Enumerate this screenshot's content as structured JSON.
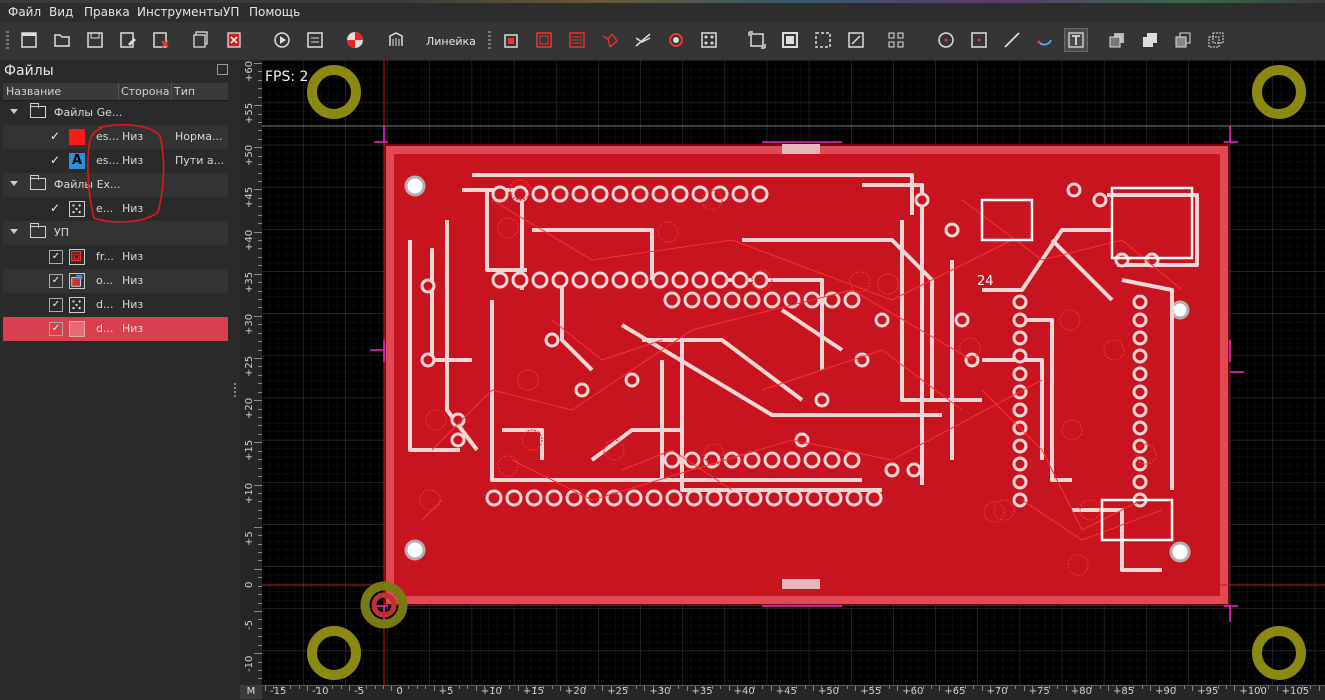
{
  "menu": {
    "items": [
      "Файл",
      "Вид",
      "Правка",
      "Инструменты",
      "УП",
      "Помощь"
    ]
  },
  "toolbar": {
    "ruler_label": "Линейка",
    "buttons": [
      "new-file-icon",
      "open-folder-icon",
      "save-icon",
      "save-as-icon",
      "close-file-icon",
      "save-all-icon",
      "close-all-icon",
      "run-icon",
      "settings-icon",
      "color-icon",
      "gcode-icon",
      "profile-icon",
      "pocket-icon",
      "pocket-raster-icon",
      "voronoi-icon",
      "thermal-icon",
      "drill-icon",
      "hatch-icon",
      "zero-icon",
      "home-icon",
      "boundary-icon",
      "shapes-icon",
      "circle-icon",
      "rectangle-icon",
      "line-icon",
      "arc-icon",
      "text-icon",
      "group-icon",
      "union-icon",
      "intersect-icon",
      "diff-icon"
    ]
  },
  "files_panel": {
    "title": "Файлы",
    "columns": {
      "name": "Название",
      "side": "Сторона",
      "type": "Тип"
    },
    "groups": [
      {
        "label": "Файлы Ge...",
        "items": [
          {
            "name": "es...",
            "side": "Низ",
            "type": "Норма...",
            "icon": "gerber-copper-icon",
            "color": "#ff1a1a"
          },
          {
            "name": "es...",
            "side": "Низ",
            "type": "Пути а...",
            "icon": "gerber-text-icon",
            "color": "#2f8ee0"
          }
        ]
      },
      {
        "label": "Файлы Ex...",
        "items": [
          {
            "name": "e...",
            "side": "Низ",
            "type": "",
            "icon": "excellon-drill-icon"
          }
        ]
      },
      {
        "label": "УП",
        "items": [
          {
            "name": "fr...",
            "side": "Низ",
            "type": "",
            "icon": "profile-toolpath-icon"
          },
          {
            "name": "o...",
            "side": "Низ",
            "type": "",
            "icon": "pocket-toolpath-icon"
          },
          {
            "name": "d...",
            "side": "Низ",
            "type": "",
            "icon": "drill-toolpath-icon"
          },
          {
            "name": "d...",
            "side": "Низ",
            "type": "",
            "icon": "drill-toolpath-icon",
            "selected": true
          }
        ]
      }
    ]
  },
  "canvas": {
    "fps_text": "FPS: 2",
    "corner_label": "M",
    "x_ticks": [
      "-15",
      "-10",
      "-5",
      "0",
      "+5",
      "+10",
      "+15",
      "+20",
      "+25",
      "+30",
      "+35",
      "+40",
      "+45",
      "+50",
      "+55",
      "+60",
      "+65",
      "+70",
      "+75",
      "+80",
      "+85",
      "+90",
      "+95",
      "+100",
      "+105"
    ],
    "y_ticks": [
      "+60",
      "+55",
      "+50",
      "+45",
      "+40",
      "+35",
      "+30",
      "+25",
      "+20",
      "+15",
      "+10",
      "+5",
      "0",
      "-5",
      "-10"
    ],
    "colors": {
      "board": "#c8141e",
      "trace": "#f2d6d6",
      "toolpath": "#ff1a1a",
      "marker": "#ff00cc",
      "pin": "#8a8a12"
    }
  }
}
